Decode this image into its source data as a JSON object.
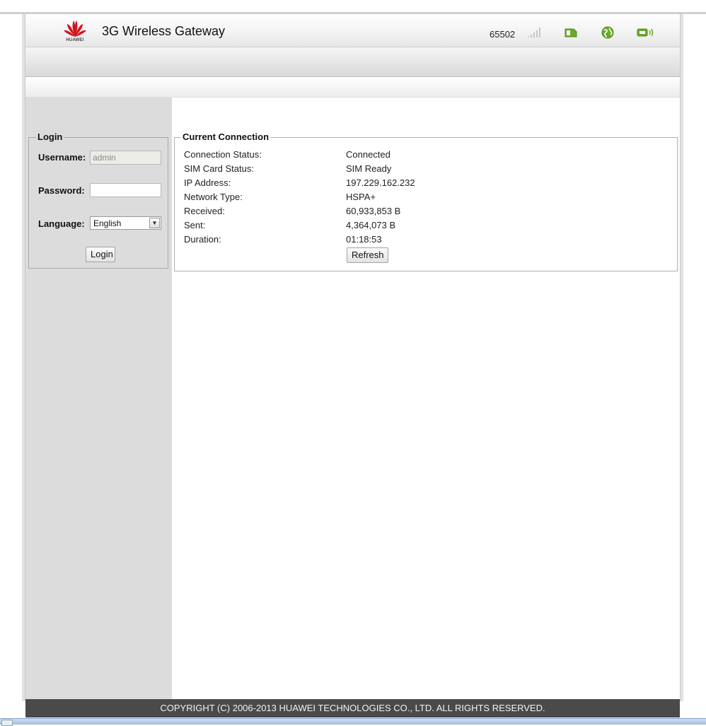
{
  "header": {
    "logo_text": "HUAWEI",
    "title": "3G Wireless Gateway",
    "operator": "65502",
    "icons": [
      "signal-strength-icon",
      "sim-card-icon",
      "internet-globe-icon",
      "wifi-icon"
    ],
    "accent_color": "#6aa92a",
    "logo_color": "#d4121b"
  },
  "login": {
    "legend": "Login",
    "username_label": "Username:",
    "username_value": "admin",
    "password_label": "Password:",
    "password_value": "",
    "language_label": "Language:",
    "language_value": "English",
    "login_button": "Login"
  },
  "connection": {
    "legend": "Current Connection",
    "rows": [
      {
        "label": "Connection Status:",
        "value": "Connected"
      },
      {
        "label": "SIM Card Status:",
        "value": "SIM Ready"
      },
      {
        "label": "IP Address:",
        "value": "197.229.162.232"
      },
      {
        "label": "Network Type:",
        "value": "HSPA+"
      },
      {
        "label": "Received:",
        "value": "60,933,853 B"
      },
      {
        "label": "Sent:",
        "value": "4,364,073 B"
      },
      {
        "label": "Duration:",
        "value": "01:18:53"
      }
    ],
    "refresh_button": "Refresh"
  },
  "footer": {
    "copyright": "COPYRIGHT (C) 2006-2013 HUAWEI TECHNOLOGIES CO., LTD. ALL RIGHTS RESERVED."
  }
}
